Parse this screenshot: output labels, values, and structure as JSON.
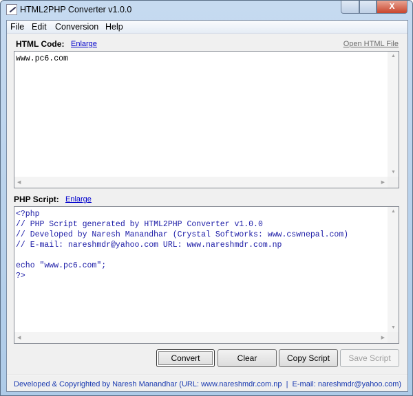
{
  "window": {
    "title": "HTML2PHP Converter v1.0.0",
    "close_glyph": "X"
  },
  "menu": [
    "File",
    "Edit",
    "Conversion",
    "Help"
  ],
  "html_section": {
    "label": "HTML Code:",
    "enlarge": "Enlarge",
    "open_file": "Open HTML File",
    "content": "www.pc6.com"
  },
  "php_section": {
    "label": "PHP Script:",
    "enlarge": "Enlarge",
    "content": "<?php\n// PHP Script generated by HTML2PHP Converter v1.0.0\n// Developed by Naresh Manandhar (Crystal Softworks: www.cswnepal.com)\n// E-mail: nareshmdr@yahoo.com URL: www.nareshmdr.com.np\n\necho \"www.pc6.com\";\n?>"
  },
  "buttons": {
    "convert": "Convert",
    "clear": "Clear",
    "copy": "Copy Script",
    "save": "Save Script"
  },
  "footer": "Developed & Copyrighted by Naresh Manandhar (URL: www.nareshmdr.com.np  |  E-mail: nareshmdr@yahoo.com)",
  "colors": {
    "php_text": "#1a1aa6",
    "footer": "#1a3ab0"
  }
}
